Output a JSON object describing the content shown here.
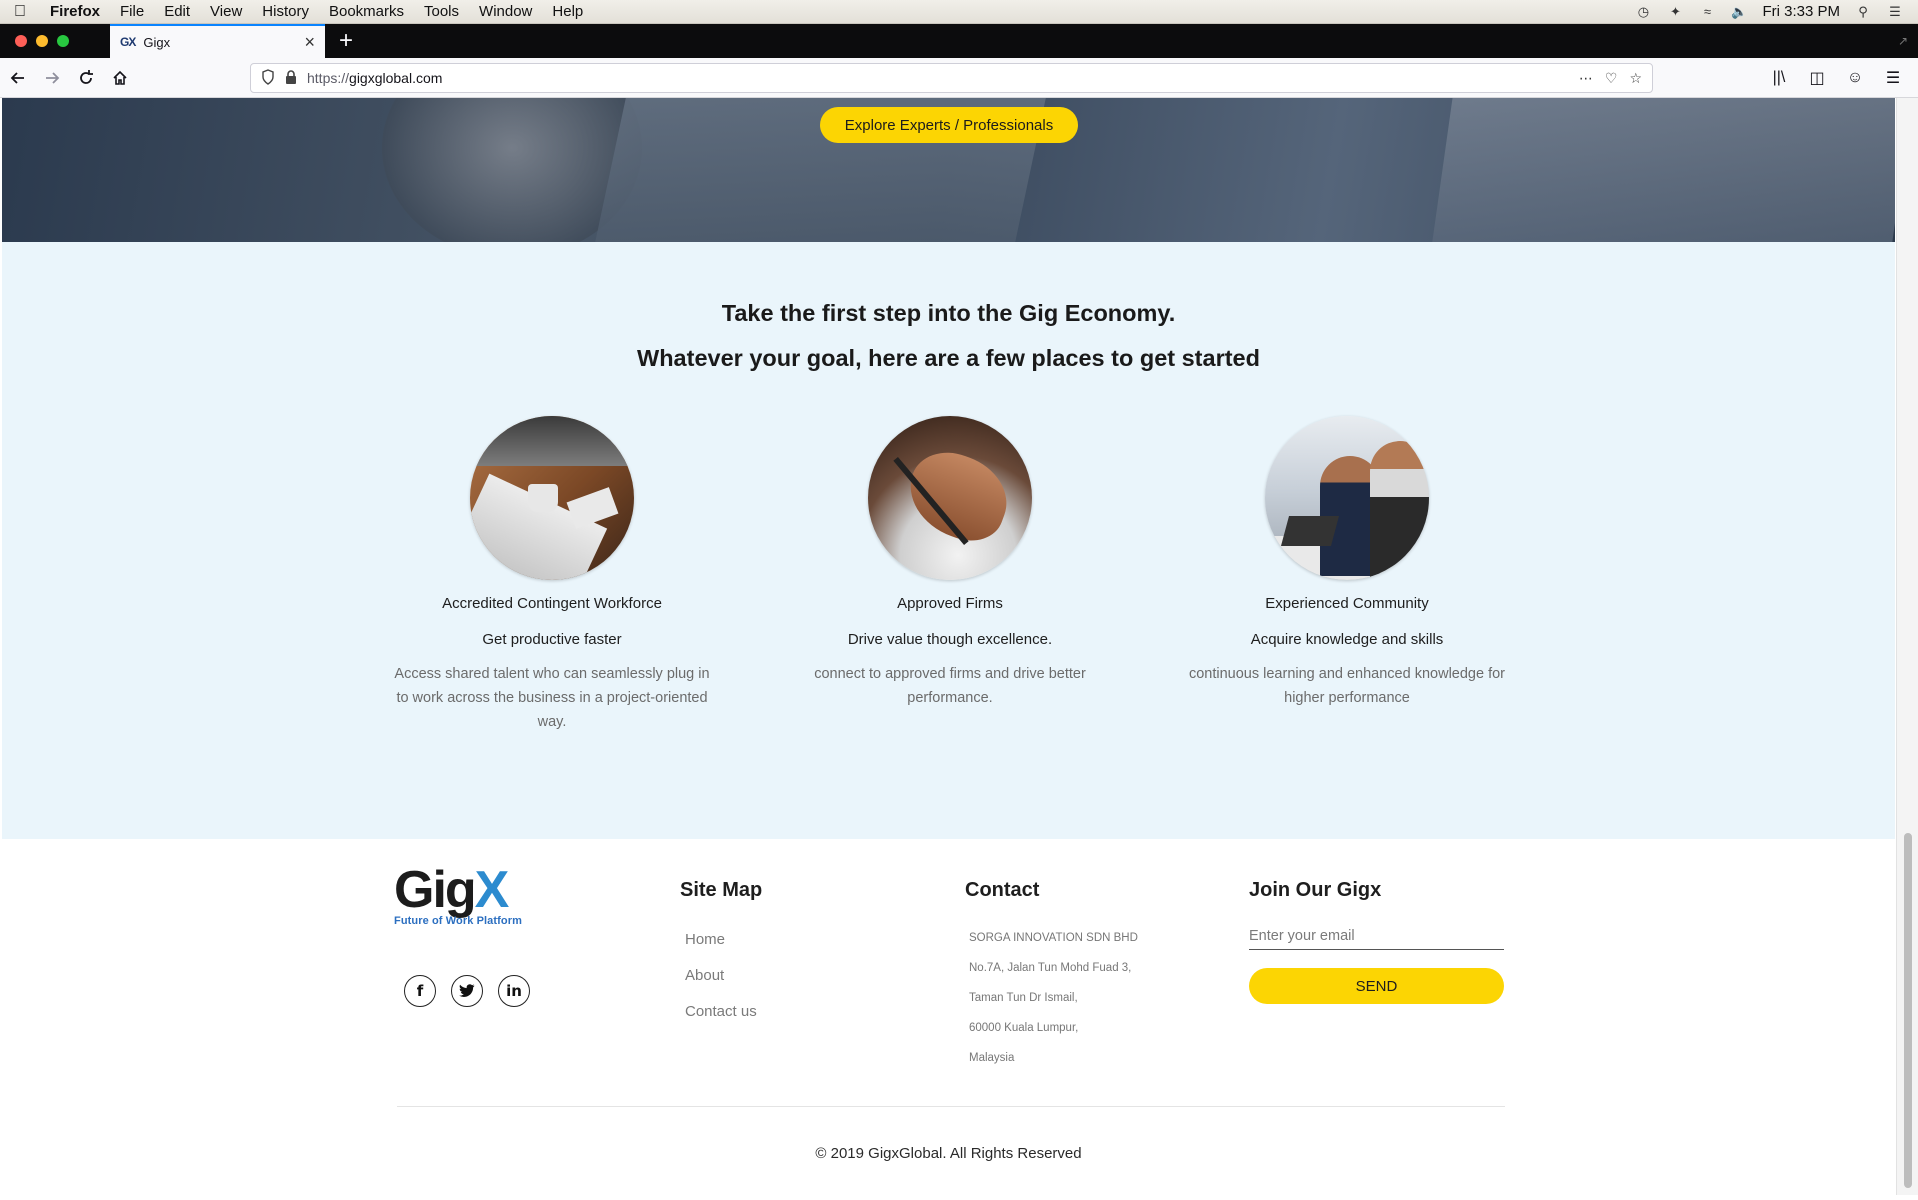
{
  "menubar": {
    "app": "Firefox",
    "items": [
      "File",
      "Edit",
      "View",
      "History",
      "Bookmarks",
      "Tools",
      "Window",
      "Help"
    ],
    "clock": "Fri 3:33 PM"
  },
  "browser": {
    "tab_title": "Gigx",
    "tab_favicon": "GX",
    "url_scheme": "https://",
    "url_host": "gigxglobal.com"
  },
  "hero": {
    "button_label": "Explore Experts / Professionals"
  },
  "get_started": {
    "title_line1": "Take the first step into the Gig Economy.",
    "title_line2": "Whatever your goal, here are a few places to get started",
    "cards": [
      {
        "title": "Accredited Contingent Workforce",
        "subtitle": "Get productive faster",
        "description": "Access shared talent who can seamlessly plug in to work across the business in a project-oriented way."
      },
      {
        "title": "Approved Firms",
        "subtitle": "Drive value though excellence.",
        "description": "connect to approved firms and drive better performance."
      },
      {
        "title": "Experienced Community",
        "subtitle": "Acquire knowledge and skills",
        "description": "continuous learning and enhanced knowledge for higher performance"
      }
    ]
  },
  "footer": {
    "logo": {
      "gig": "Gig",
      "x": "X",
      "tagline": "Future of Work Platform"
    },
    "social": [
      "f",
      "t",
      "in"
    ],
    "sitemap": {
      "heading": "Site Map",
      "links": [
        "Home",
        "About",
        "Contact us"
      ]
    },
    "contact": {
      "heading": "Contact",
      "lines": [
        "SORGA INNOVATION SDN BHD",
        "No.7A, Jalan Tun Mohd Fuad 3,",
        "Taman Tun Dr Ismail,",
        "60000 Kuala Lumpur,",
        "Malaysia"
      ]
    },
    "join": {
      "heading": "Join Our Gigx",
      "email_placeholder": "Enter your email",
      "send_label": "SEND"
    },
    "copyright": "© 2019 GigxGlobal. All Rights Reserved"
  },
  "colors": {
    "accent_yellow": "#fcd503",
    "section_bg": "#eaf5fb",
    "logo_blue": "#2c8bcf"
  }
}
